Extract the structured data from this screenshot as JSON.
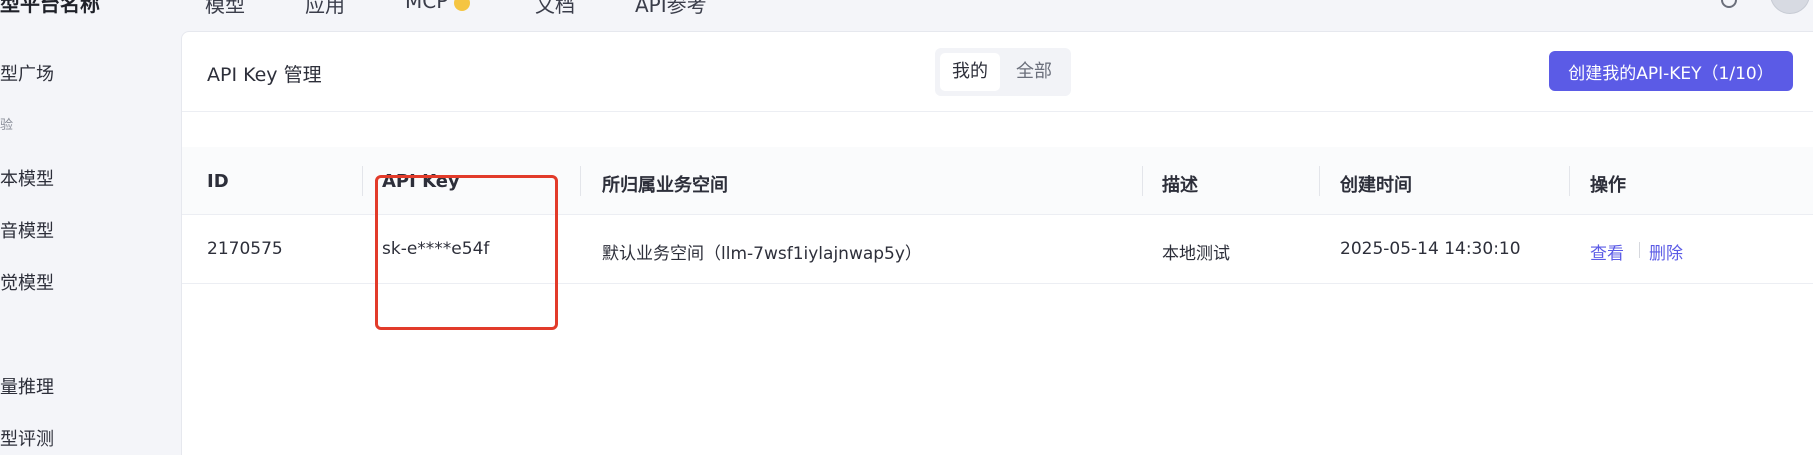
{
  "topnav": {
    "brand": "型平台名称",
    "items": [
      "模型",
      "应用",
      "MCP",
      "文档",
      "API参考"
    ]
  },
  "sidebar": {
    "items": [
      {
        "label": "型广场"
      },
      {
        "section": "验"
      },
      {
        "label": "本模型"
      },
      {
        "label": "音模型"
      },
      {
        "label": "觉模型"
      },
      {
        "label": "量推理"
      },
      {
        "label": "型评测"
      }
    ]
  },
  "page": {
    "title": "API Key 管理",
    "segments": [
      "我的",
      "全部"
    ],
    "active_segment": "我的",
    "create_button": "创建我的API-KEY（1/10）"
  },
  "table": {
    "headers": [
      "ID",
      "API Key",
      "所归属业务空间",
      "描述",
      "创建时间",
      "操作"
    ],
    "rows": [
      {
        "id": "2170575",
        "api_key": "sk-e****e54f",
        "workspace": "默认业务空间（llm-7wsf1iylajnwap5y）",
        "description": "本地测试",
        "created_at": "2025-05-14 14:30:10",
        "actions": [
          "查看",
          "删除"
        ]
      }
    ]
  },
  "colors": {
    "accent": "#5b5be6",
    "highlight": "#e23b2a"
  }
}
